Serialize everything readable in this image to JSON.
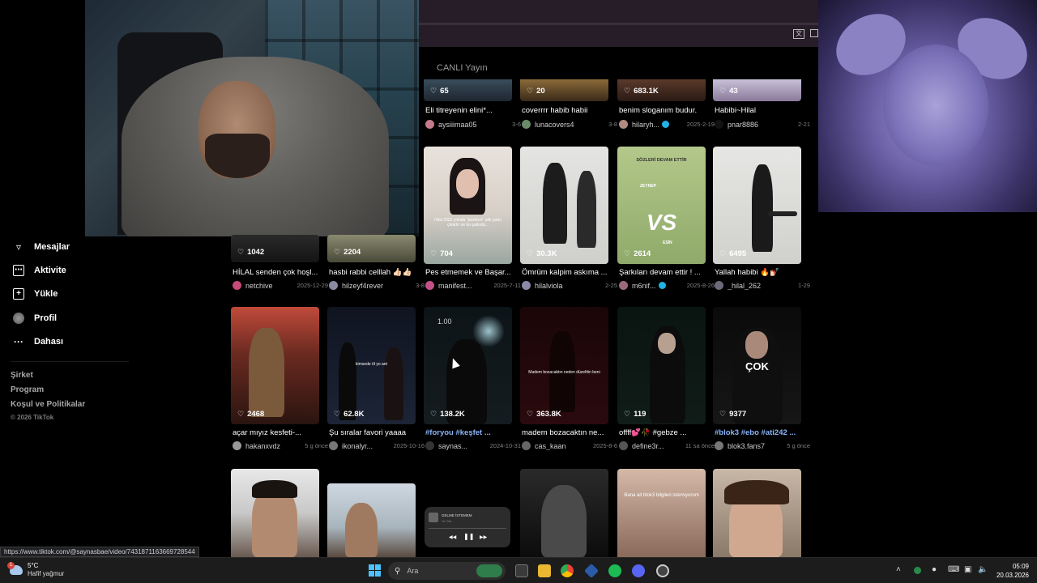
{
  "browser": {
    "live_label": "CANLI Yayın",
    "translate_icon": "translate-icon",
    "status_url": "https://www.tiktok.com/@saynasbae/video/7431871163669728544"
  },
  "sidebar": {
    "items": [
      {
        "label": "Mesajlar",
        "icon": "send-icon"
      },
      {
        "label": "Aktivite",
        "icon": "chat-icon"
      },
      {
        "label": "Yükle",
        "icon": "plus-icon"
      },
      {
        "label": "Profil",
        "icon": "avatar"
      },
      {
        "label": "Dahası",
        "icon": "more-icon"
      }
    ],
    "footer": [
      "Şirket",
      "Program",
      "Koşul ve Politikalar"
    ],
    "copyright": "© 2026 TikTok"
  },
  "videos": {
    "row0": [
      {
        "likes": "65",
        "caption": "Eli titreyenin elini*...",
        "user": "aysiiimaa05",
        "date": "3-6"
      },
      {
        "likes": "20",
        "caption": "coverrrr habib habii",
        "user": "lunacovers4",
        "date": "3-8"
      },
      {
        "likes": "683.1K",
        "caption": "benim sloganım budur.",
        "user": "hilaryh...",
        "date": "2025-2-19"
      },
      {
        "likes": "43",
        "caption": "Habibi~Hilal",
        "user": "pnar8886",
        "date": "2-21"
      }
    ],
    "row1": [
      {
        "likes": "1042",
        "caption": "HİLAL senden çok hoşl...",
        "user": "netchive",
        "date": "2025-12-29"
      },
      {
        "likes": "2204",
        "caption": "hasbi rabbi celllah 👍🏻👍🏻",
        "user": "hilzeyf4rever",
        "date": "3-8"
      },
      {
        "likes": "704",
        "caption": "Pes etmemek ve Başar...",
        "user": "manifest...",
        "date": "2025-7-11"
      },
      {
        "likes": "30.3K",
        "caption": "Ömrüm kalpim askıma ...",
        "user": "hilalviola",
        "date": "2-25"
      },
      {
        "likes": "2614",
        "caption": "Şarkıları devam ettir ! ...",
        "user": "m6nif...",
        "date": "2025-8-26"
      },
      {
        "likes": "6495",
        "caption": "Yallah habibi 🔥💅🏻",
        "user": "_hilal_262",
        "date": "1-29"
      }
    ],
    "row2": [
      {
        "likes": "2468",
        "caption": "açar mıyız kesfeti-...",
        "user": "hakanxvdz",
        "date": "5 g önce"
      },
      {
        "likes": "62.8K",
        "caption": "Şu sıralar favori yaaaa",
        "user": "ikonalyr...",
        "date": "2025-10-16"
      },
      {
        "likes": "138.2K",
        "caption": "#foryou #keşfet ...",
        "user": "saynas...",
        "date": "2024-10-31"
      },
      {
        "likes": "363.8K",
        "caption": "madem bozacaktın ne...",
        "user": "cas_kaan",
        "date": "2025-8-6"
      },
      {
        "likes": "119",
        "caption": "offff💕🥀 #gebze ...",
        "user": "define3r...",
        "date": "11 sa önce"
      },
      {
        "likes": "9377",
        "caption": "#blok3 #ebo #ati242 ...",
        "user": "blok3.fans7",
        "date": "5 g önce"
      }
    ],
    "thumb_text": {
      "r1c2": "Hilal 2022 yılında \"pizofren\" adlı şarkı çıkartır ve bu şarkıda...",
      "r1c4_top": "SÖZLERİ DEVAM ETTİR",
      "r1c4_vs": "VS",
      "r1c4_left": "ZEYNEP",
      "r1c4_right": "ESİN",
      "r2c1": "kimsede öl yo ant",
      "r2c2_rate": "1.00",
      "r2c3": "Madem bozacaktın neden düzelttin beni",
      "r2c5": "ÇOK",
      "r3c4": "Bana ait blok3 bilgileri istemiyorum"
    }
  },
  "mini_player": {
    "title": "GELME İSTEMEM",
    "subtitle": "Ye Orb"
  },
  "taskbar": {
    "temp": "5°C",
    "condition": "Hafif yağmur",
    "search_placeholder": "Ara",
    "time": "05:09",
    "date": "20.03.2026",
    "weather_badge": "1"
  }
}
